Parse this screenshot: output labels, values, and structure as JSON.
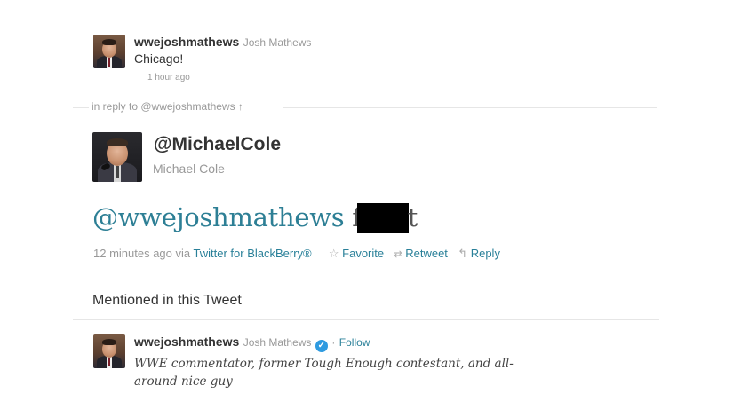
{
  "tweet1": {
    "screen_name": "wwejoshmathews",
    "real_name": "Josh Mathews",
    "text": "Chicago!",
    "time": "1 hour ago"
  },
  "reply_to": {
    "prefix": "in reply to ",
    "handle": "@wwejoshmathews",
    "arrow": "↑"
  },
  "main_tweet": {
    "screen_name": "@MichaelCole",
    "real_name": "Michael Cole",
    "text_handle": "@wwejoshmathews",
    "text_start": "f",
    "text_end": "t",
    "time": "12 minutes ago",
    "via_prefix": " via ",
    "client": "Twitter for BlackBerry®",
    "actions": {
      "favorite": "Favorite",
      "retweet": "Retweet",
      "reply": "Reply"
    }
  },
  "mentioned": {
    "heading": "Mentioned in this Tweet",
    "screen_name": "wwejoshmathews",
    "real_name": "Josh Mathews",
    "follow_sep": "·",
    "follow": "Follow",
    "bio": "WWE commentator, former Tough Enough contestant, and all-around nice guy"
  },
  "icons": {
    "favorite": "star-outline-icon",
    "retweet": "retweet-icon",
    "reply": "reply-arrow-icon",
    "verified": "verified-badge-icon"
  },
  "colors": {
    "link": "#2a8099",
    "big_text": "#2d7f95",
    "muted": "#999999",
    "verified": "#2f9be0",
    "redaction": "#000000"
  }
}
